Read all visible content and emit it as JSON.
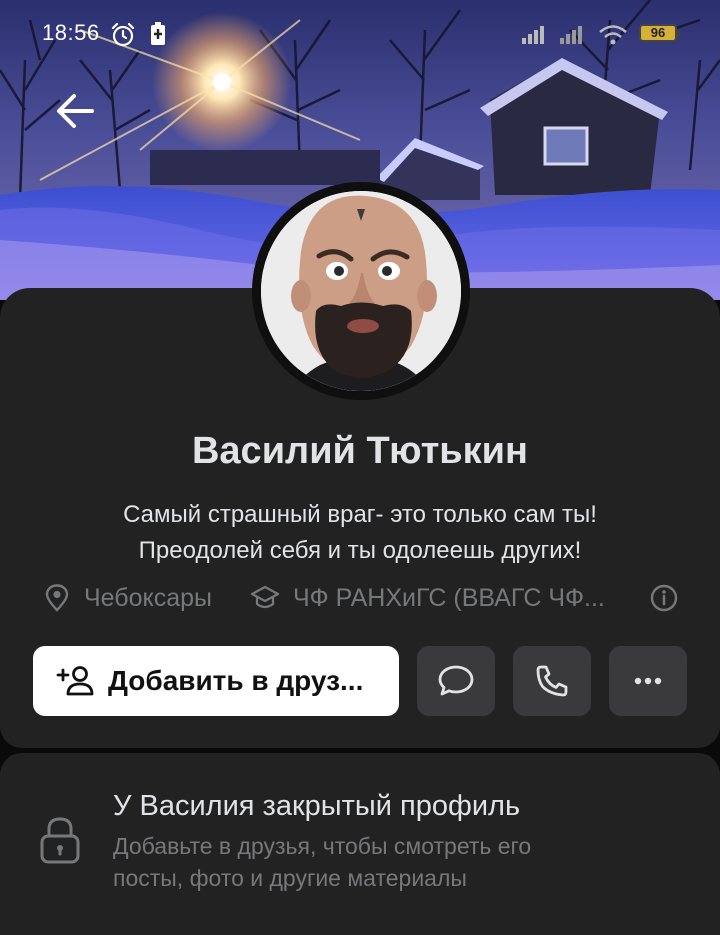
{
  "status_bar": {
    "time": "18:56",
    "battery": "96"
  },
  "profile": {
    "name": "Василий Тютькин",
    "status_line_1": "Самый страшный враг- это только сам ты!",
    "status_line_2": "Преодолей себя и ты одолеешь других!",
    "city": "Чебоксары",
    "education": "ЧФ РАНХиГС (ВВАГС ЧФ..."
  },
  "actions": {
    "add_friend_label": "Добавить в друз..."
  },
  "private_profile": {
    "title": "У Василия закрытый профиль",
    "description_line_1": "Добавьте в друзья, чтобы смотреть его",
    "description_line_2": "посты, фото и другие материалы"
  },
  "icons": {
    "back": "arrow-left-icon",
    "alarm": "alarm-icon",
    "battery_saver": "battery-saver-icon",
    "signal": "signal-icon",
    "wifi": "wifi-icon",
    "location": "location-pin-icon",
    "education": "graduation-cap-icon",
    "info": "info-icon",
    "add_friend": "add-friend-icon",
    "message": "message-icon",
    "call": "phone-icon",
    "more": "more-icon",
    "lock": "lock-icon"
  },
  "colors": {
    "card_background": "#222223",
    "page_background": "#0a0a0a",
    "primary_text": "#e1e3e6",
    "secondary_text": "#76787a",
    "primary_button": "#ffffff",
    "secondary_button": "#3a3a3c",
    "battery": "#d7b03a"
  }
}
